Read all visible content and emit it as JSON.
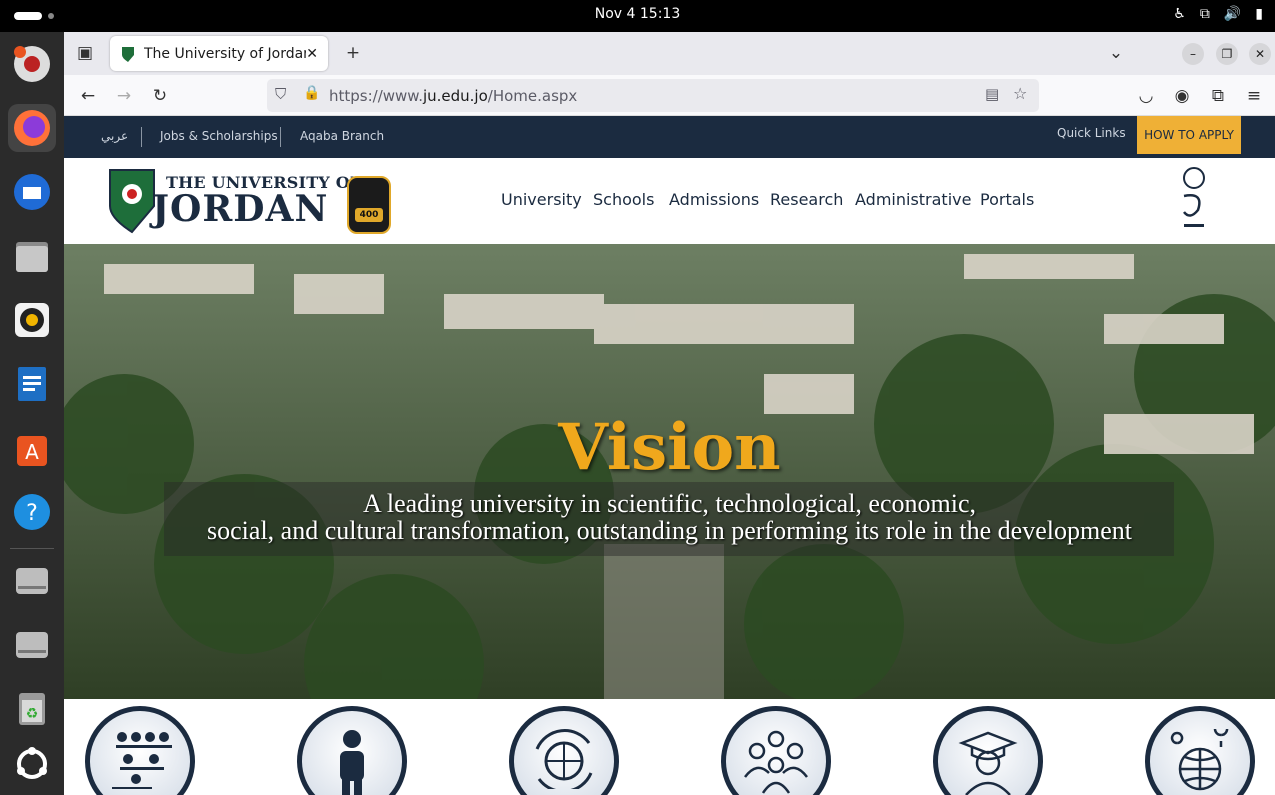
{
  "system": {
    "clock": "Nov 4  15:13"
  },
  "dock": {
    "items": [
      "Disk Usage Analyzer",
      "Firefox",
      "Thunderbird",
      "Files",
      "Rhythmbox",
      "LibreOffice Writer",
      "App Center",
      "Help",
      "Disk",
      "Disk",
      "Trash",
      "Show Apps"
    ]
  },
  "browser": {
    "tab_title": "The University of Jordan",
    "url_prefix": "https://www.",
    "url_domain": "ju.edu.jo",
    "url_path": "/Home.aspx"
  },
  "site": {
    "utility": {
      "arabic": "عربي",
      "jobs": "Jobs & Scholarships",
      "aqaba": "Aqaba Branch",
      "quick_links": "Quick Links",
      "apply": "HOW TO APPLY"
    },
    "brand": {
      "line1": "THE UNIVERSITY OF",
      "line2": "JORDAN",
      "badge_number": "400"
    },
    "menu": [
      "University",
      "Schools",
      "Admissions",
      "Research",
      "Administrative",
      "Portals"
    ],
    "hero": {
      "title": "Vision",
      "line1": "A leading university in scientific, technological, economic,",
      "line2": "social, and cultural transformation, outstanding in performing its role in the development"
    },
    "feature_icons": [
      "classroom-icon",
      "student-icon",
      "global-exchange-icon",
      "community-icon",
      "graduate-icon",
      "globe-locations-icon"
    ],
    "colors": {
      "navy": "#1b2b40",
      "gold": "#efb036",
      "vision": "#f0a81c"
    }
  }
}
